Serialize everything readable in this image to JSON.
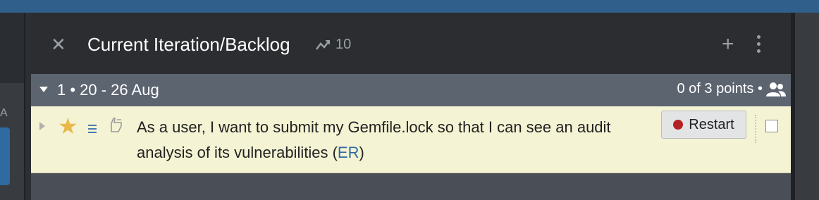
{
  "sidebar": {
    "letter": "A"
  },
  "panel": {
    "title": "Current Iteration/Backlog",
    "velocity": "10"
  },
  "iteration": {
    "label": "1 • 20 - 26 Aug",
    "points": "0 of 3 points •"
  },
  "story": {
    "text": "As a user, I want to submit my Gemfile.lock so that I can see an audit analysis of its vulnerabilities (",
    "label": "ER",
    "text_end": ")",
    "state_button": "Restart"
  },
  "colors": {
    "topbar": "#2f5f8a",
    "iteration_header": "#5c6470",
    "story_background": "#f4f3d4",
    "star": "#e8b84b",
    "restart_dot": "#b22222"
  }
}
